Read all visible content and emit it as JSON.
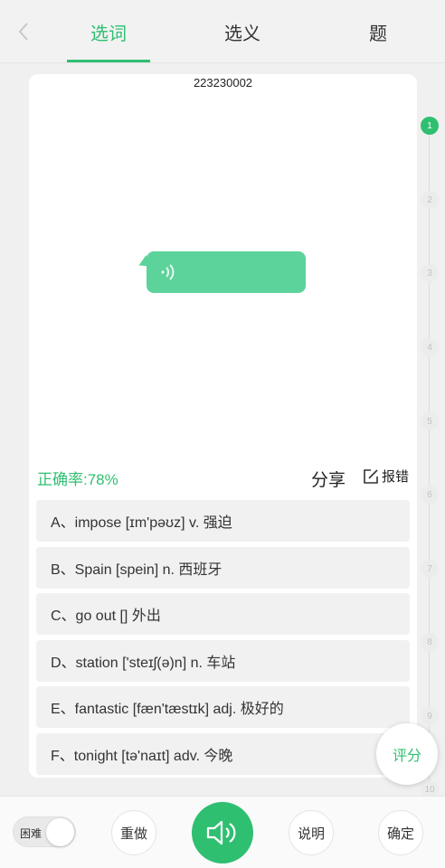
{
  "header": {
    "tabs": [
      {
        "label": "选词",
        "active": true
      },
      {
        "label": "选义",
        "active": false
      },
      {
        "label": "题",
        "active": false
      }
    ]
  },
  "card": {
    "question_id": "223230002",
    "accuracy": "正确率:78%",
    "share_label": "分享",
    "report_label": "报错",
    "options": [
      "A、impose [ɪm'pəʊz] v. 强迫",
      "B、Spain [spein] n. 西班牙",
      "C、go out [] 外出",
      "D、station ['steɪʃ(ə)n] n. 车站",
      "E、fantastic [fæn'tæstɪk] adj. 极好的",
      "F、tonight [tə'naɪt] adv. 今晚"
    ]
  },
  "progress": {
    "steps": [
      "1",
      "2",
      "3",
      "4",
      "5",
      "6",
      "7",
      "8",
      "9",
      "10"
    ],
    "current": 1
  },
  "score_label": "评分",
  "bottom": {
    "difficulty_label": "困难",
    "redo_label": "重做",
    "explain_label": "说明",
    "confirm_label": "确定"
  },
  "colors": {
    "accent": "#2fbf71",
    "bubble": "#5cd39a",
    "option_bg": "#f1f1f1"
  }
}
